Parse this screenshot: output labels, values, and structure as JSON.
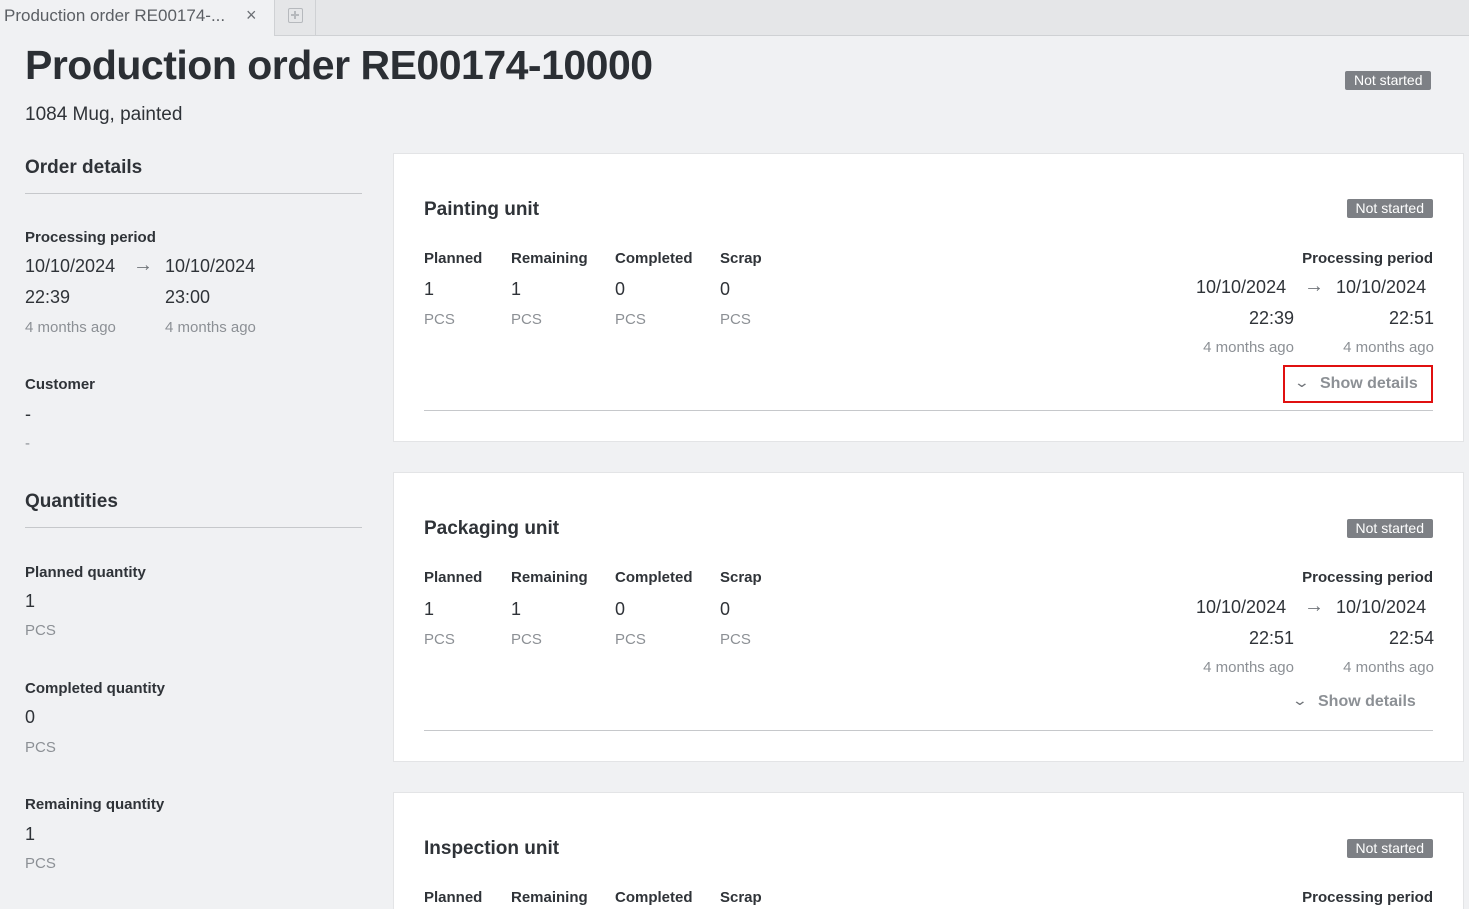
{
  "tab": {
    "title": "Production order RE00174-...",
    "close": "×"
  },
  "page": {
    "title": "Production order RE00174-10000",
    "subtitle": "1084 Mug, painted",
    "status": "Not started"
  },
  "order_details": {
    "heading": "Order details",
    "processing_period": {
      "label": "Processing period",
      "start_date": "10/10/2024",
      "start_time": "22:39",
      "start_ago": "4 months ago",
      "end_date": "10/10/2024",
      "end_time": "23:00",
      "end_ago": "4 months ago"
    },
    "customer": {
      "label": "Customer",
      "value": "-",
      "sub": "-"
    }
  },
  "quantities": {
    "heading": "Quantities",
    "planned": {
      "label": "Planned quantity",
      "value": "1",
      "unit": "PCS"
    },
    "completed": {
      "label": "Completed quantity",
      "value": "0",
      "unit": "PCS"
    },
    "remaining": {
      "label": "Remaining quantity",
      "value": "1",
      "unit": "PCS"
    }
  },
  "columns": {
    "planned": "Planned",
    "remaining": "Remaining",
    "completed": "Completed",
    "scrap": "Scrap",
    "processing_period": "Processing period"
  },
  "units": [
    {
      "title": "Painting unit",
      "status": "Not started",
      "planned": "1",
      "remaining": "1",
      "completed": "0",
      "scrap": "0",
      "unit": "PCS",
      "start_date": "10/10/2024",
      "start_time": "22:39",
      "start_ago": "4 months ago",
      "end_date": "10/10/2024",
      "end_time": "22:51",
      "end_ago": "4 months ago",
      "show_details": "Show details"
    },
    {
      "title": "Packaging unit",
      "status": "Not started",
      "planned": "1",
      "remaining": "1",
      "completed": "0",
      "scrap": "0",
      "unit": "PCS",
      "start_date": "10/10/2024",
      "start_time": "22:51",
      "start_ago": "4 months ago",
      "end_date": "10/10/2024",
      "end_time": "22:54",
      "end_ago": "4 months ago",
      "show_details": "Show details"
    },
    {
      "title": "Inspection unit",
      "status": "Not started"
    }
  ]
}
